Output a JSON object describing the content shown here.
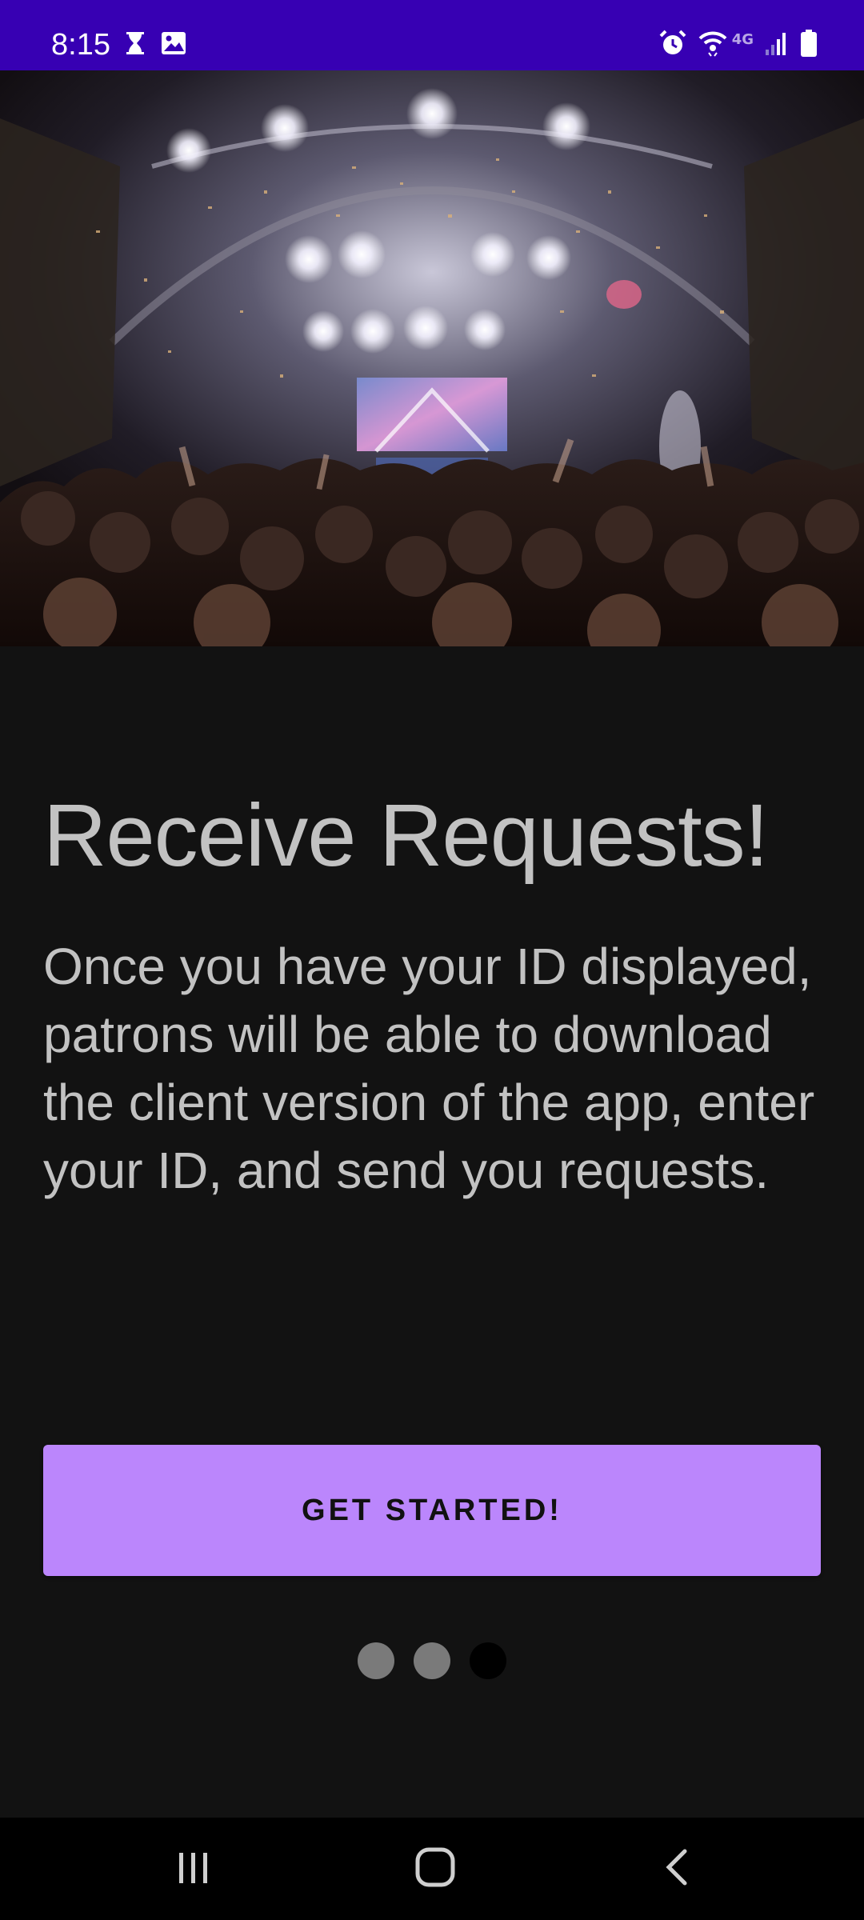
{
  "status_bar": {
    "time": "8:15",
    "network_label": "4G",
    "left_icons": [
      "hourglass-icon",
      "image-icon"
    ],
    "right_icons": [
      "alarm-icon",
      "wifi-icon",
      "signal-icon",
      "battery-icon"
    ],
    "background_color": "#3700b3"
  },
  "hero": {
    "description_icon": "concert-photo"
  },
  "onboarding": {
    "title": "Receive Requests!",
    "body": "Once you have your ID displayed, patrons will be able to download the client version of the app, enter your ID, and send you requests.",
    "cta_label": "GET STARTED!",
    "cta_color": "#bb86fc",
    "page_count": 3,
    "current_page": 3
  },
  "nav_bar": {
    "buttons": [
      "recent-apps-icon",
      "home-icon",
      "back-icon"
    ]
  }
}
